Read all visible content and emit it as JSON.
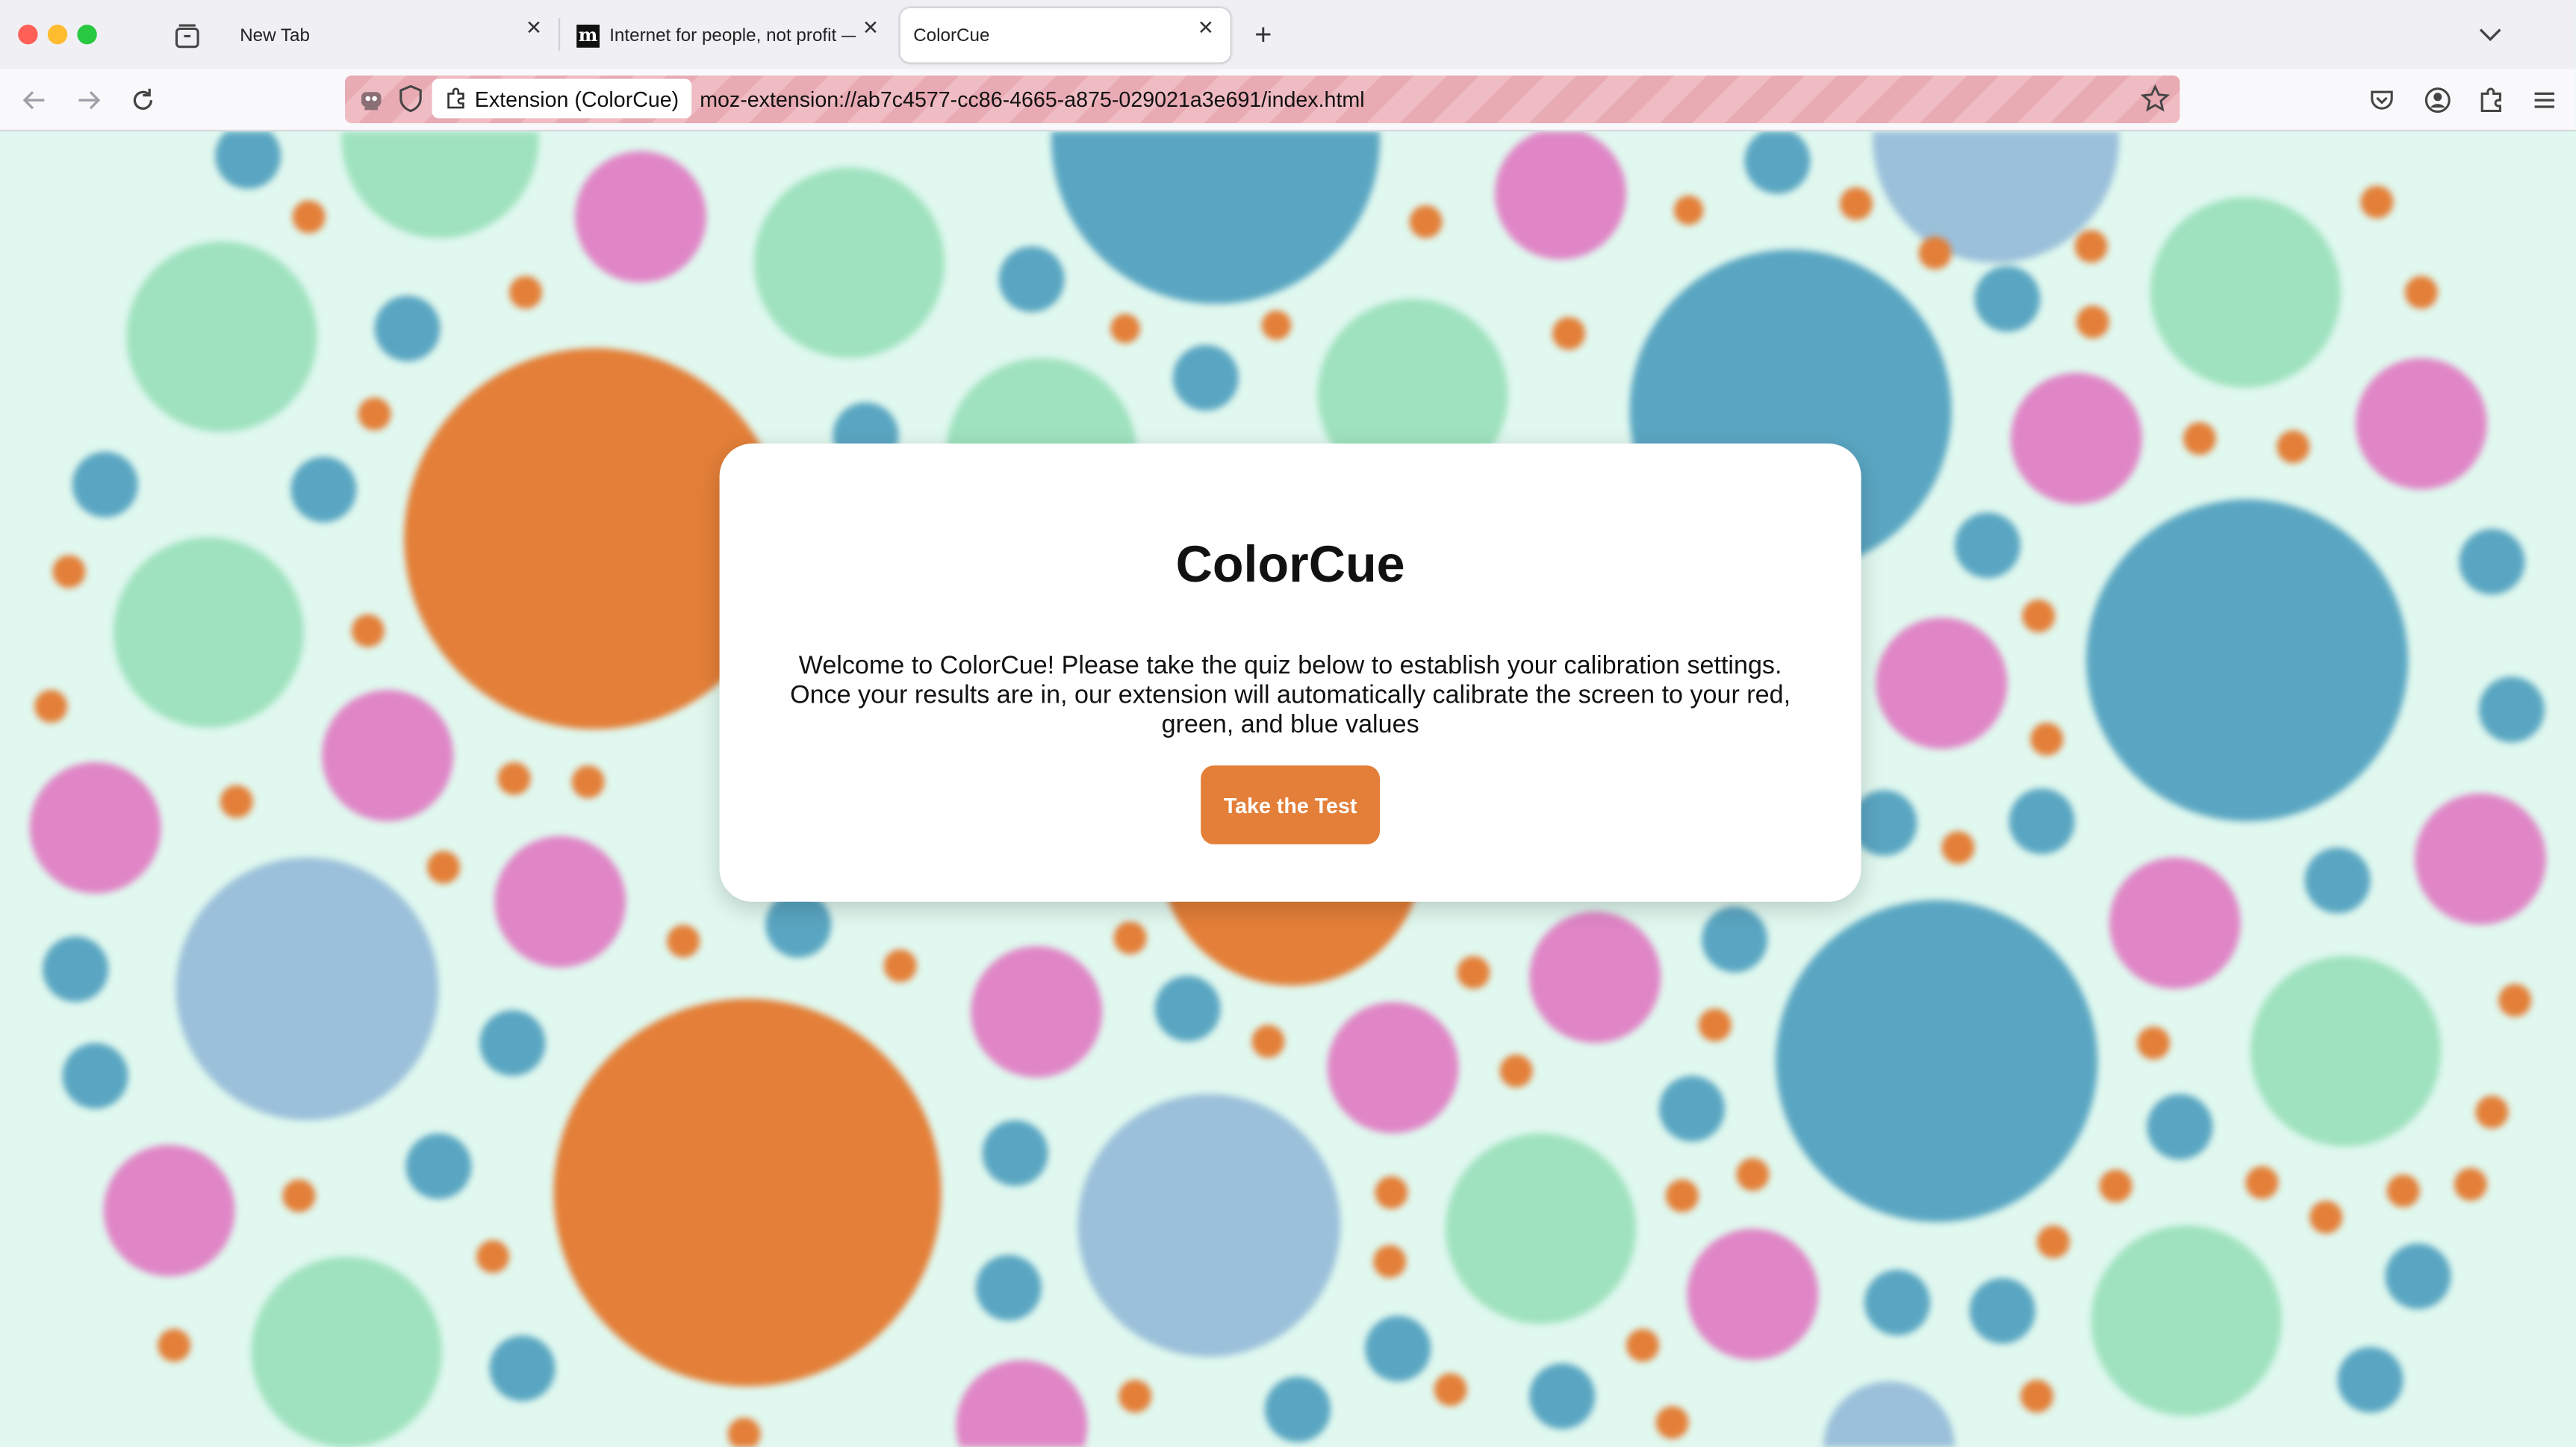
{
  "browser": {
    "tabs": [
      {
        "title": "New Tab",
        "active": false
      },
      {
        "title": "Internet for people, not profit —",
        "active": false
      },
      {
        "title": "ColorCue",
        "active": true
      }
    ],
    "url_chip": "Extension (ColorCue)",
    "url": "moz-extension://ab7c4577-cc86-4665-a875-029021a3e691/index.html",
    "icons": {
      "back": "arrow-left-icon",
      "forward": "arrow-right-icon",
      "reload": "reload-icon",
      "bookmark": "star-icon",
      "pocket": "pocket-icon",
      "account": "account-icon",
      "extensions": "puzzle-icon",
      "menu": "hamburger-menu-icon"
    }
  },
  "card": {
    "title": "ColorCue",
    "description": "Welcome to ColorCue! Please take the quiz below to establish your calibration settings. Once your results are in, our extension will automatically calibrate the screen to your red, green, and blue values",
    "button_label": "Take the Test"
  },
  "colors": {
    "background": "#e0f8ef",
    "bubble_orange": "#e37f38",
    "bubble_teal": "#5aa6c2",
    "bubble_green": "#9fe2bf",
    "bubble_pink": "#e086c6",
    "bubble_lightblue": "#9bc0da",
    "button": "#e37f38"
  }
}
